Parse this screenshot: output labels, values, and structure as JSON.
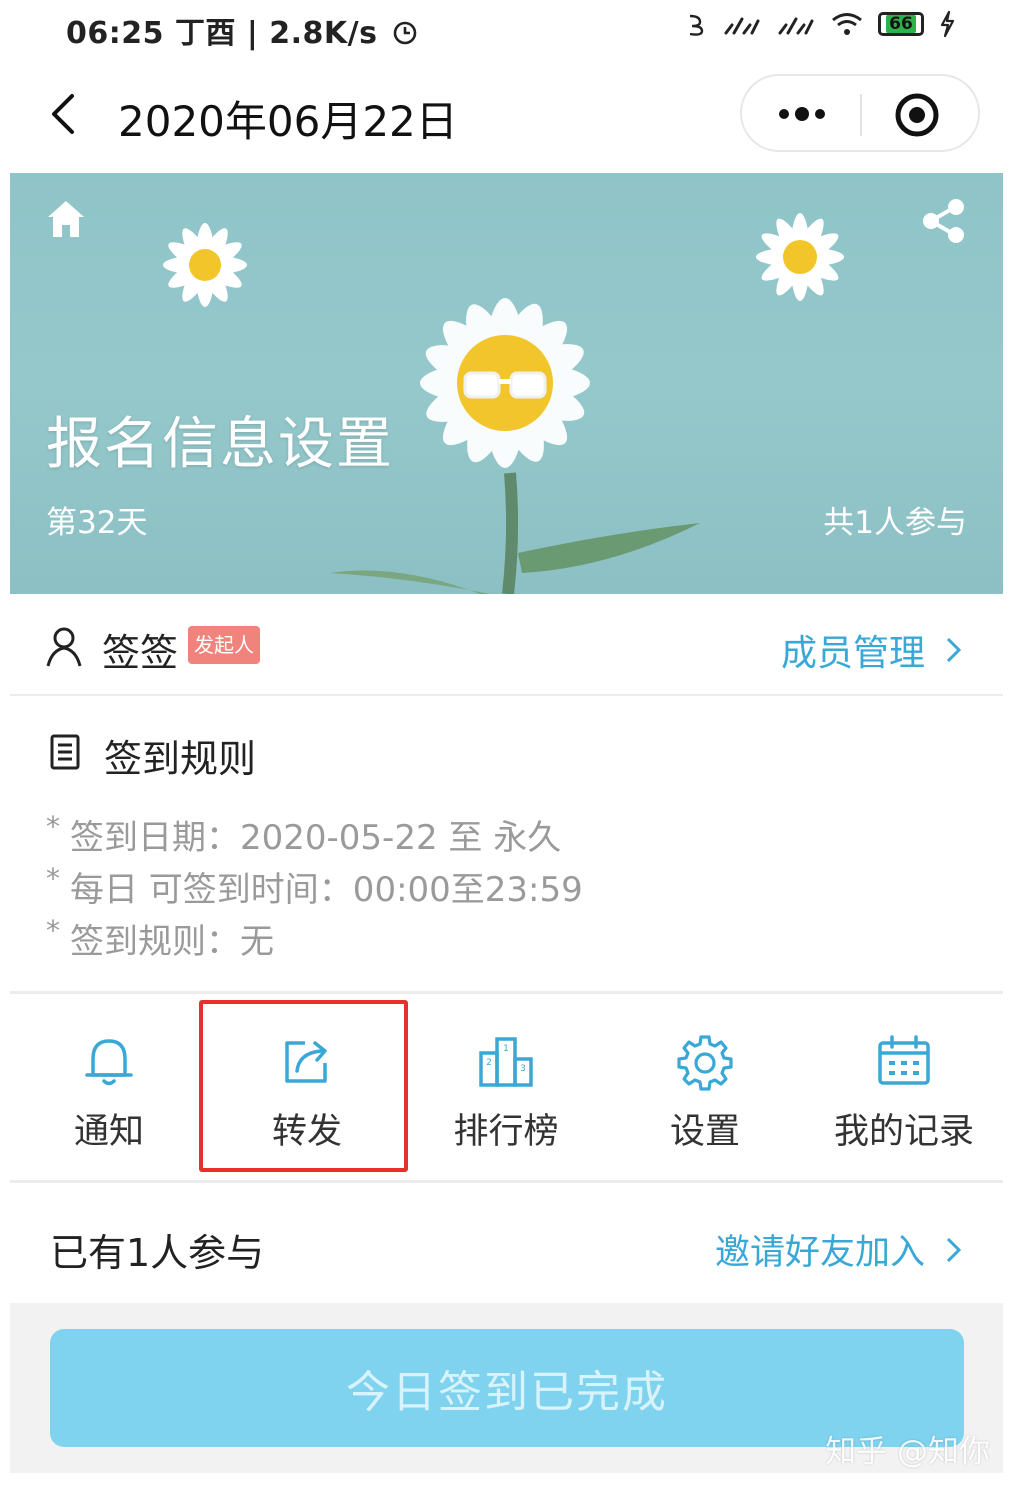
{
  "status_bar": {
    "time_info": "06:25 丁酉 | 2.8K/s",
    "battery": "66"
  },
  "nav": {
    "title": "2020年06月22日"
  },
  "banner": {
    "title": "报名信息设置",
    "day": "第32天",
    "participants": "共1人参与"
  },
  "initiator": {
    "name": "签签",
    "badge": "发起人",
    "member_management": "成员管理"
  },
  "rules": {
    "title": "签到规则",
    "items": [
      "签到日期：2020-05-22 至 永久",
      "每日 可签到时间：00:00至23:59",
      "签到规则：无"
    ]
  },
  "actions": [
    {
      "label": "通知",
      "icon": "bell-icon"
    },
    {
      "label": "转发",
      "icon": "forward-icon"
    },
    {
      "label": "排行榜",
      "icon": "podium-icon"
    },
    {
      "label": "设置",
      "icon": "gear-icon"
    },
    {
      "label": "我的记录",
      "icon": "calendar-icon"
    }
  ],
  "participants": {
    "text": "已有1人参与",
    "invite": "邀请好友加入"
  },
  "checkin_button": "今日签到已完成",
  "watermark": "知乎 @知你",
  "colors": {
    "accent": "#3aa8d6",
    "button": "#7fd3ef",
    "badge": "#f1837d",
    "highlight": "#e5302b",
    "banner": "#8fc4c8"
  }
}
